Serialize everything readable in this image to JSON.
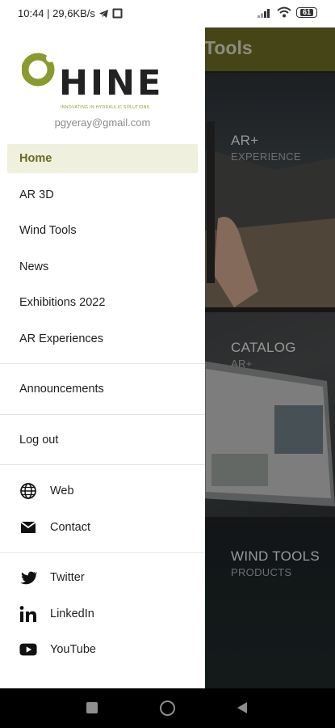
{
  "status_bar": {
    "time_info": "10:44 | 29,6KB/s",
    "battery": "61"
  },
  "app": {
    "title": "Tools",
    "cards": [
      {
        "title": "AR+",
        "subtitle": "EXPERIENCE"
      },
      {
        "title": "CATALOG",
        "subtitle": "AR+"
      },
      {
        "title": "WIND TOOLS",
        "subtitle": "PRODUCTS"
      }
    ]
  },
  "drawer": {
    "logo_text": "HINE",
    "logo_tagline": "INNOVATING IN HYDRAULIC SOLUTIONS",
    "email": "pgyeray@gmail.com",
    "items": [
      {
        "label": "Home"
      },
      {
        "label": "AR 3D"
      },
      {
        "label": "Wind Tools"
      },
      {
        "label": "News"
      },
      {
        "label": "Exhibitions 2022"
      },
      {
        "label": "AR Experiences"
      },
      {
        "label": "Announcements"
      },
      {
        "label": "Log out"
      },
      {
        "label": "Web",
        "icon": "globe-icon"
      },
      {
        "label": "Contact",
        "icon": "mail-icon"
      },
      {
        "label": "Twitter",
        "icon": "twitter-icon"
      },
      {
        "label": "LinkedIn",
        "icon": "linkedin-icon"
      },
      {
        "label": "YouTube",
        "icon": "youtube-icon"
      }
    ]
  },
  "colors": {
    "accent": "#6b6a24",
    "active_bg": "#eff0dd",
    "logo_green": "#8b9a2e"
  }
}
